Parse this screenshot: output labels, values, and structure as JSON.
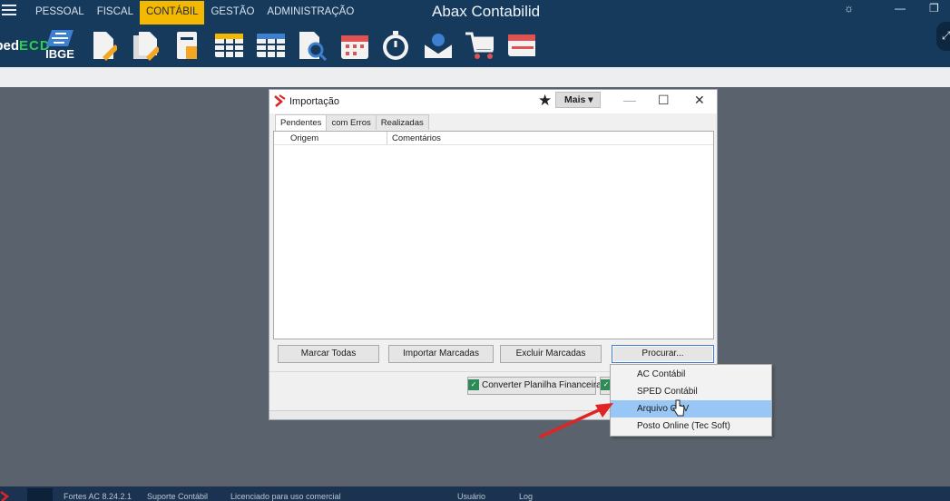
{
  "app": {
    "title": "Abax Contabilid",
    "menu": [
      "PESSOAL",
      "FISCAL",
      "CONTÁBIL",
      "GESTÃO",
      "ADMINISTRAÇÃO"
    ],
    "active_menu": "CONTÁBIL",
    "toolbar": {
      "sped_line1": "Sped",
      "sped_line2": "ECD",
      "ibge_label": "IBGE"
    }
  },
  "dialog": {
    "title": "Importação",
    "mais_label": "Mais ▾",
    "tabs": [
      "Pendentes",
      "com Erros",
      "Realizadas"
    ],
    "columns": [
      "Origem",
      "Comentários"
    ],
    "buttons": {
      "marcar_todas": "Marcar Todas",
      "importar_marcadas": "Importar Marcadas",
      "excluir_marcadas": "Excluir Marcadas",
      "procurar": "Procurar...",
      "converter": "Converter Planilha Financeira"
    }
  },
  "popup_menu": {
    "items": [
      "AC Contábil",
      "SPED Contábil",
      "Arquivo CSV",
      "Posto Online (Tec Soft)"
    ],
    "highlighted_index": 2
  },
  "status_bar": {
    "items": [
      "Fortes AC 8.24.2.1",
      "Suporte Contábil",
      "Licenciado para uso comercial",
      "Usuário",
      "Log"
    ]
  },
  "colors": {
    "app_bar": "#163a5c",
    "active_menu": "#f5b800",
    "desktop": "#5a636d",
    "highlight": "#99c7f5",
    "arrow": "#e02424"
  }
}
